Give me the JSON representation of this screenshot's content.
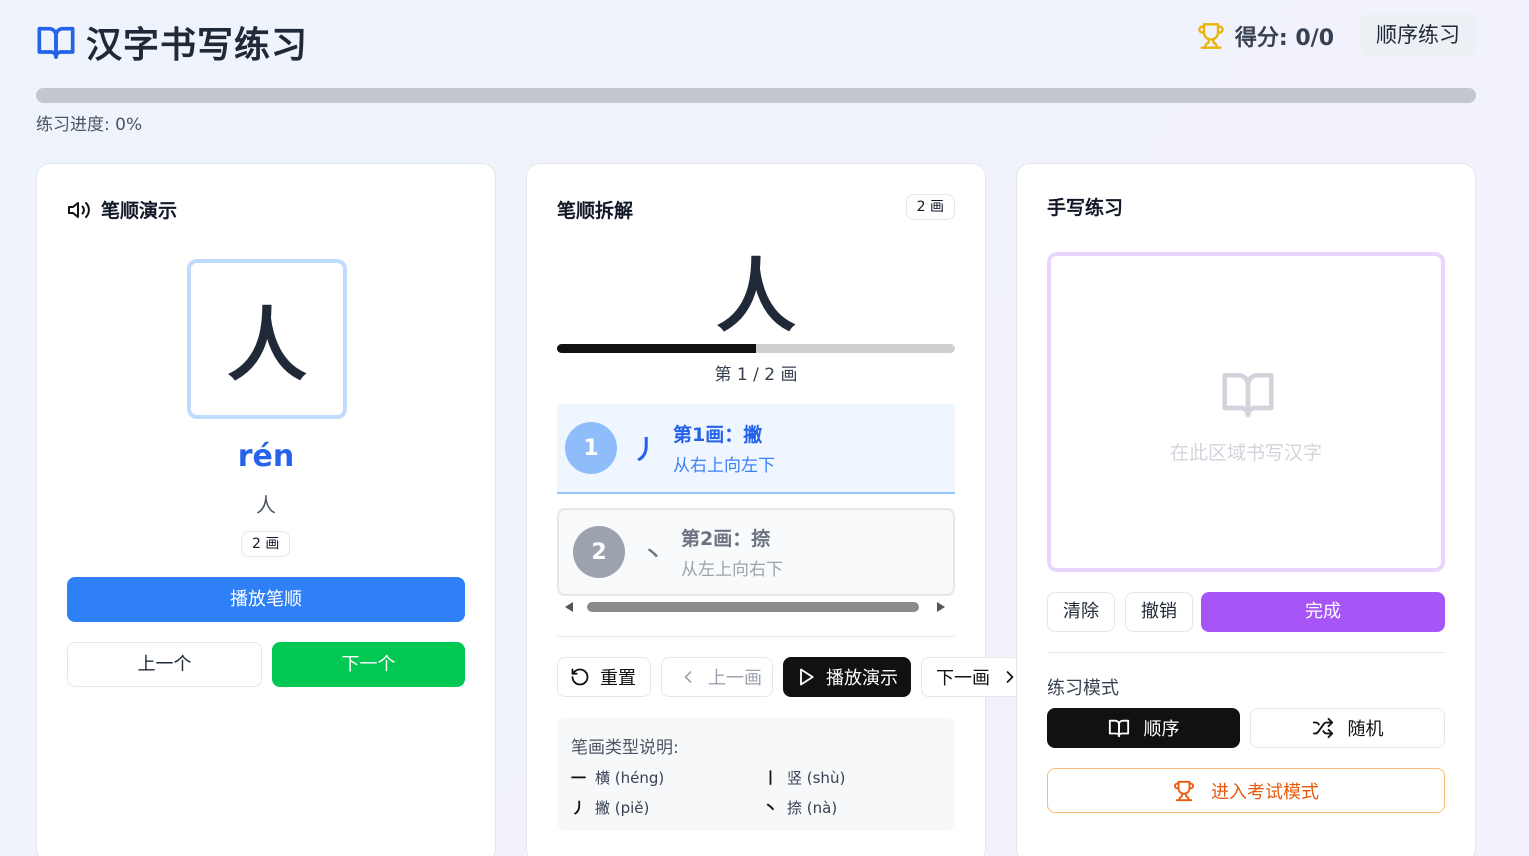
{
  "header": {
    "title": "汉字书写练习",
    "logo_icon": "book-icon",
    "score_label": "得分: 0/0",
    "score_icon": "trophy-icon",
    "mode_button": "顺序练习"
  },
  "progress": {
    "value_percent": 0,
    "label": "练习进度: 0%"
  },
  "demo_card": {
    "title": "笔顺演示",
    "title_icon": "speaker-icon",
    "character": "人",
    "pinyin": "rén",
    "meaning": "人",
    "strokes_badge": "2 画",
    "play_button": "播放笔顺",
    "prev_button": "上一个",
    "next_button": "下一个"
  },
  "breakdown_card": {
    "title": "笔顺拆解",
    "strokes_badge": "2 画",
    "character": "人",
    "stroke_progress_fraction": 0.5,
    "stroke_counter": "第 1 / 2 画",
    "strokes": [
      {
        "number": "1",
        "glyph": "丿",
        "name": "第1画：撇",
        "description": "从右上向左下",
        "active": true
      },
      {
        "number": "2",
        "glyph": "丶",
        "name": "第2画：捺",
        "description": "从左上向右下",
        "active": false
      }
    ],
    "controls": {
      "reset": "重置",
      "prev": "上一画",
      "play": "播放演示",
      "next": "下一画"
    },
    "legend": {
      "title": "笔画类型说明:",
      "items": [
        {
          "glyph": "一",
          "label": "横 (héng)"
        },
        {
          "glyph": "丨",
          "label": "竖 (shù)"
        },
        {
          "glyph": "丿",
          "label": "撇 (piě)"
        },
        {
          "glyph": "丶",
          "label": "捺 (nà)"
        }
      ]
    }
  },
  "practice_card": {
    "title": "手写练习",
    "canvas_hint": "在此区域书写汉字",
    "clear_button": "清除",
    "undo_button": "撤销",
    "done_button": "完成",
    "mode_label": "练习模式",
    "sequential_button": "顺序",
    "random_button": "随机",
    "exam_button": "进入考试模式"
  },
  "colors": {
    "primary_blue": "#2f80f7",
    "green": "#00c853",
    "purple": "#a855f7",
    "orange": "#ea580c",
    "trophy": "#eab308"
  }
}
